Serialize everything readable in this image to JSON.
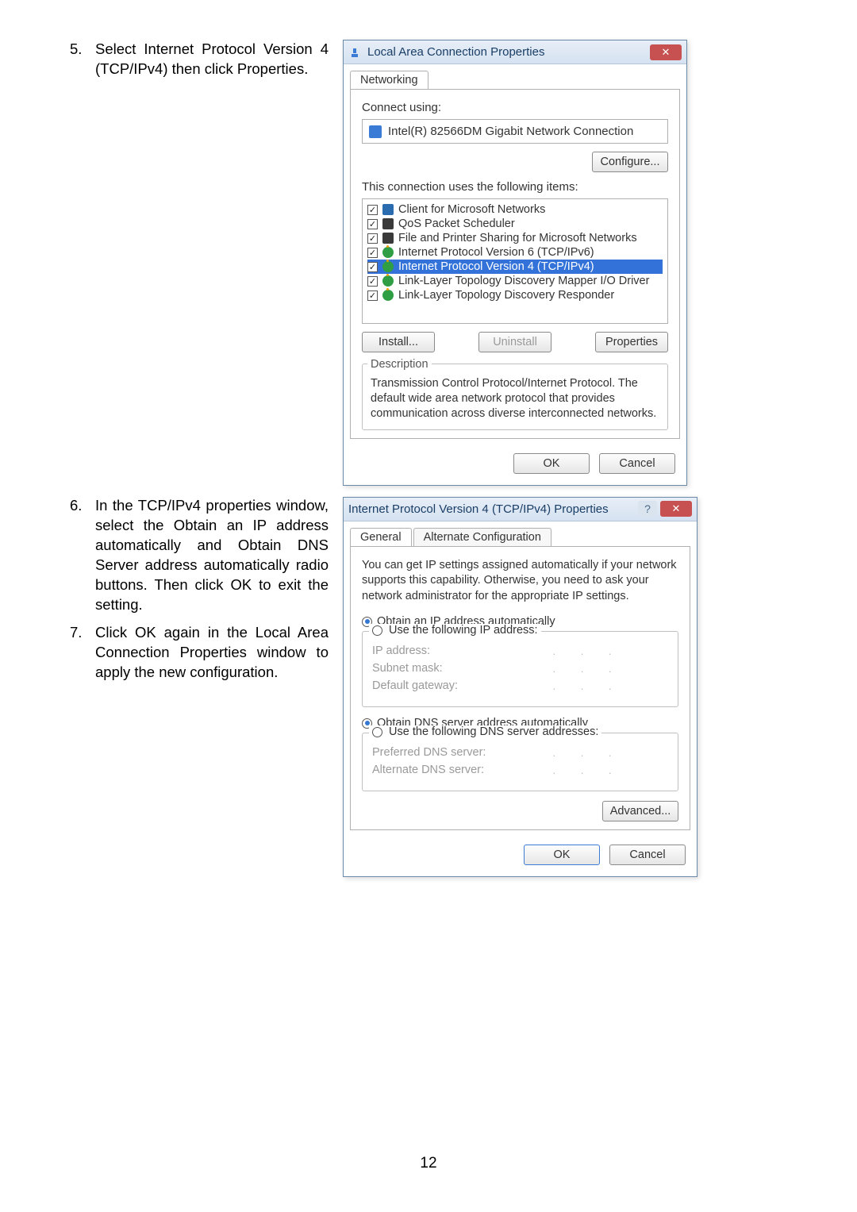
{
  "steps": [
    {
      "num": "5.",
      "text": "Select Internet Protocol Version 4 (TCP/IPv4) then click Properties."
    },
    {
      "num": "6.",
      "text": "In the TCP/IPv4 properties window, select the Obtain an IP address automatically and Obtain DNS Server address automatically radio buttons. Then click OK to exit the setting."
    },
    {
      "num": "7.",
      "text": "Click OK again in the Local Area Connection Properties window to apply the new configuration."
    }
  ],
  "dlg1": {
    "title": "Local Area Connection Properties",
    "tab": "Networking",
    "connect_using_label": "Connect using:",
    "adapter": "Intel(R) 82566DM Gigabit Network Connection",
    "configure_btn": "Configure...",
    "uses_label": "This connection uses the following items:",
    "items": [
      {
        "label": "Client for Microsoft Networks",
        "icon": "pc"
      },
      {
        "label": "QoS Packet Scheduler",
        "icon": "sched"
      },
      {
        "label": "File and Printer Sharing for Microsoft Networks",
        "icon": "sched"
      },
      {
        "label": "Internet Protocol Version 6 (TCP/IPv6)",
        "icon": "net"
      },
      {
        "label": "Internet Protocol Version 4 (TCP/IPv4)",
        "icon": "net",
        "selected": true
      },
      {
        "label": "Link-Layer Topology Discovery Mapper I/O Driver",
        "icon": "net"
      },
      {
        "label": "Link-Layer Topology Discovery Responder",
        "icon": "net"
      }
    ],
    "install_btn": "Install...",
    "uninstall_btn": "Uninstall",
    "properties_btn": "Properties",
    "desc_legend": "Description",
    "desc_text": "Transmission Control Protocol/Internet Protocol. The default wide area network protocol that provides communication across diverse interconnected networks.",
    "ok_btn": "OK",
    "cancel_btn": "Cancel"
  },
  "dlg2": {
    "title": "Internet Protocol Version 4 (TCP/IPv4) Properties",
    "tabs": [
      "General",
      "Alternate Configuration"
    ],
    "intro": "You can get IP settings assigned automatically if your network supports this capability. Otherwise, you need to ask your network administrator for the appropriate IP settings.",
    "ip_auto": "Obtain an IP address automatically",
    "ip_manual_legend": "Use the following IP address:",
    "ip_fields": [
      "IP address:",
      "Subnet mask:",
      "Default gateway:"
    ],
    "dns_auto": "Obtain DNS server address automatically",
    "dns_manual_legend": "Use the following DNS server addresses:",
    "dns_fields": [
      "Preferred DNS server:",
      "Alternate DNS server:"
    ],
    "dots": ". . .",
    "advanced_btn": "Advanced...",
    "ok_btn": "OK",
    "cancel_btn": "Cancel"
  },
  "page_number": "12"
}
